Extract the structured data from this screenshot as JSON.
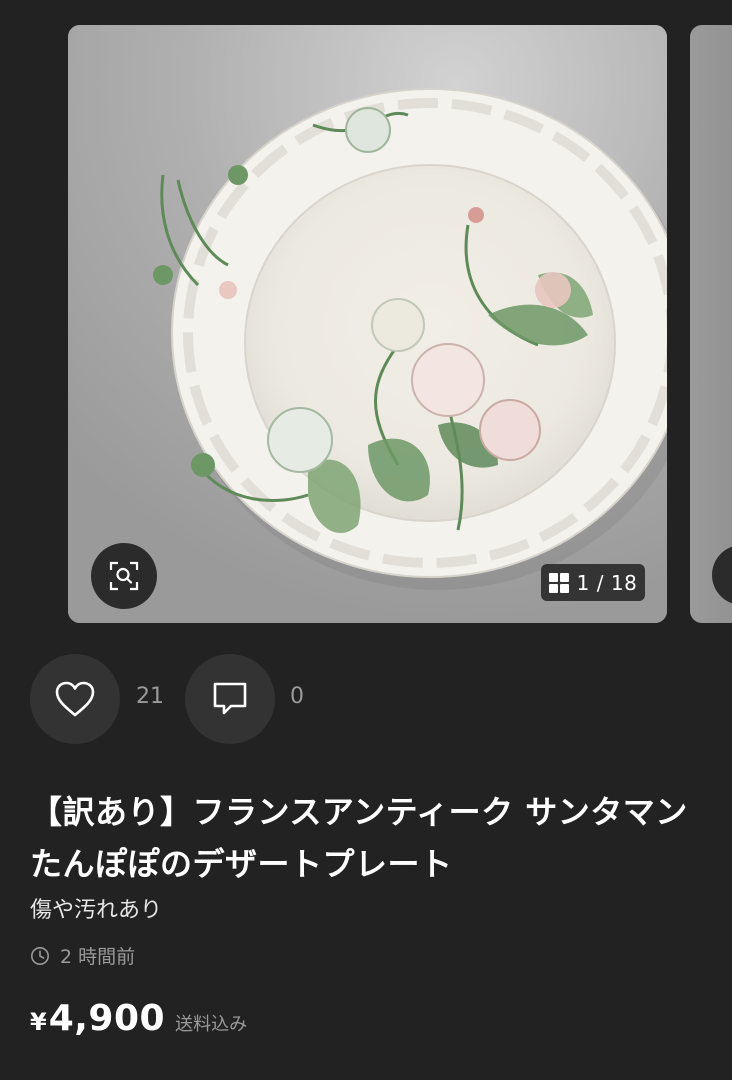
{
  "carousel": {
    "counter": "1 / 18",
    "zoom_icon": "zoom-search-icon",
    "grid_icon": "grid-icon"
  },
  "actions": {
    "like_icon": "heart-icon",
    "like_count": "21",
    "comment_icon": "comment-icon",
    "comment_count": "0"
  },
  "item": {
    "title": "【訳あり】フランスアンティーク サンタマン たんぽぽのデザートプレート",
    "subtitle": "傷や汚れあり",
    "posted": "2 時間前",
    "currency": "¥",
    "price": "4,900",
    "shipping": "送料込み"
  },
  "colors": {
    "background": "#222222",
    "button_bg": "#333333",
    "muted_text": "#9a9a9a"
  }
}
